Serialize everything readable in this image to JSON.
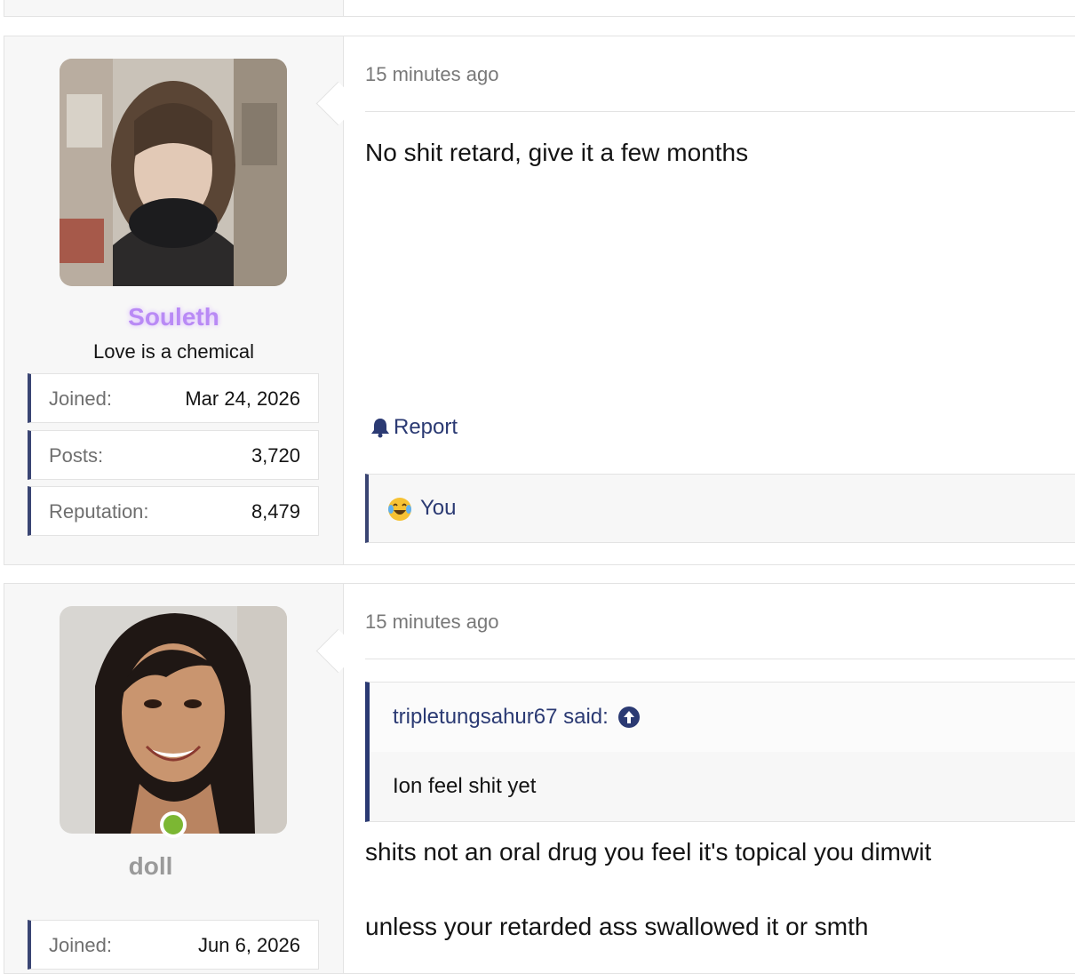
{
  "posts": [
    {
      "user": {
        "name": "Souleth",
        "title": "Love is a chemical",
        "stats": [
          {
            "label": "Joined:",
            "value": "Mar 24, 2026"
          },
          {
            "label": "Posts:",
            "value": "3,720"
          },
          {
            "label": "Reputation:",
            "value": "8,479"
          }
        ]
      },
      "timestamp": "15 minutes ago",
      "body": [
        "No shit retard, give it a few months"
      ],
      "actions": {
        "report": "Report"
      },
      "reactions": {
        "emoji": "crying-laughing-emoji",
        "who": "You"
      }
    },
    {
      "user": {
        "name": "doll",
        "online": true,
        "stats": [
          {
            "label": "Joined:",
            "value": "Jun 6, 2026"
          }
        ]
      },
      "timestamp": "15 minutes ago",
      "quote": {
        "author": "tripletungsahur67 said:",
        "text": "Ion feel shit yet"
      },
      "body": [
        "shits not an oral drug you feel it's topical you dimwit",
        "unless your retarded ass swallowed it or smth"
      ]
    }
  ],
  "colors": {
    "accent": "#2b3a73",
    "username_souleth": "#b98af5",
    "online": "#7cb733"
  }
}
